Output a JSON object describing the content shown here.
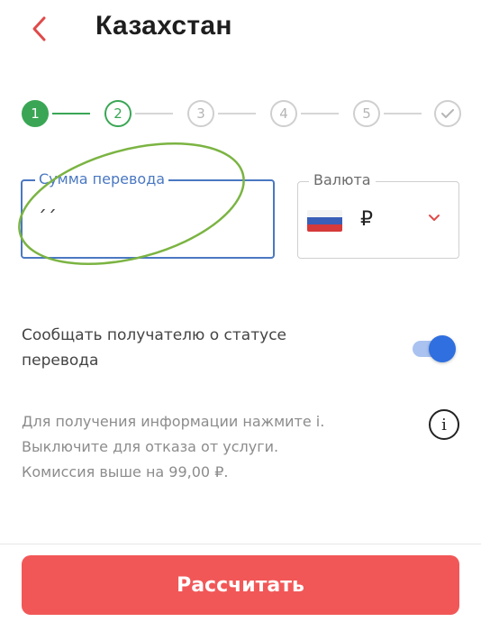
{
  "header": {
    "title": "Казахстан",
    "back_icon": "chevron-left-icon",
    "accent_color": "#e04a4a"
  },
  "stepper": {
    "steps": [
      {
        "label": "1",
        "state": "done"
      },
      {
        "label": "2",
        "state": "active"
      },
      {
        "label": "3",
        "state": "pending"
      },
      {
        "label": "4",
        "state": "pending"
      },
      {
        "label": "5",
        "state": "pending"
      },
      {
        "label": "",
        "icon": "check-icon",
        "state": "pending"
      }
    ],
    "color_done": "#3aa655"
  },
  "amount": {
    "label": "Сумма перевода",
    "value": "",
    "placeholder": "´´"
  },
  "currency": {
    "label": "Валюта",
    "flag": "russia-flag-icon",
    "value": "₽"
  },
  "notify": {
    "text": "Сообщать получателю о статусе перевода",
    "enabled": true
  },
  "info": {
    "lines": [
      "Для получения информации нажмите i.",
      "Выключите для отказа от услуги.",
      "Комиссия выше на 99,00 ₽."
    ],
    "icon": "info-icon"
  },
  "submit": {
    "label": "Рассчитать",
    "color": "#f25757"
  }
}
